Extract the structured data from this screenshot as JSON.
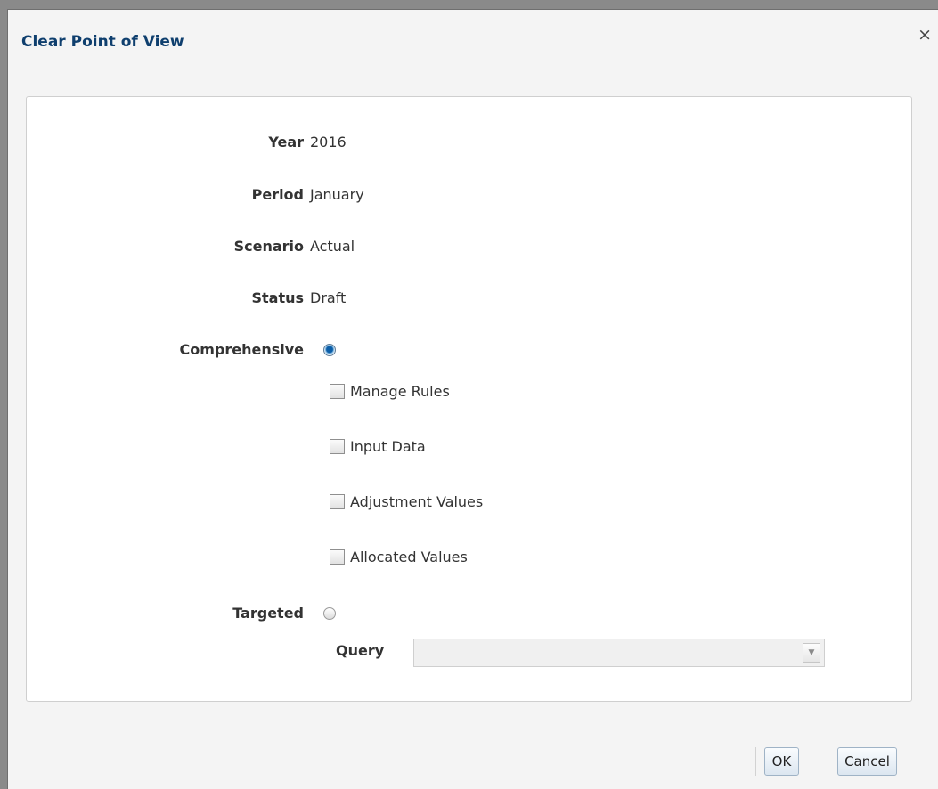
{
  "dialog": {
    "title": "Clear Point of View",
    "close_glyph": "×"
  },
  "fields": [
    {
      "label": "Year",
      "value": "2016"
    },
    {
      "label": "Period",
      "value": "January"
    },
    {
      "label": "Scenario",
      "value": "Actual"
    },
    {
      "label": "Status",
      "value": "Draft"
    }
  ],
  "options": {
    "comprehensive": {
      "label": "Comprehensive",
      "selected": true
    },
    "targeted": {
      "label": "Targeted",
      "selected": false
    }
  },
  "checkboxes": [
    {
      "label": "Manage Rules",
      "checked": false
    },
    {
      "label": "Input Data",
      "checked": false
    },
    {
      "label": "Adjustment Values",
      "checked": false
    },
    {
      "label": "Allocated Values",
      "checked": false
    }
  ],
  "query": {
    "label": "Query",
    "value": "",
    "dropdown_glyph": "▼"
  },
  "buttons": {
    "ok": "OK",
    "cancel": "Cancel"
  },
  "icons": {
    "close": "close-icon",
    "dropdown": "chevron-down-icon"
  },
  "colors": {
    "title": "#0f3f6e",
    "button_border": "#9fb3c6",
    "radio_selected": "#0b5ea8"
  }
}
